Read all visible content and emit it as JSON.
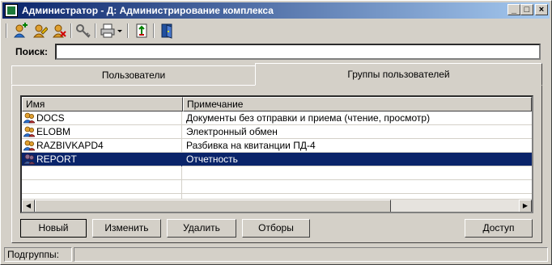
{
  "window": {
    "title": "Администратор - Д: Администрирование комплекса",
    "controls": [
      "_",
      "□",
      "×"
    ]
  },
  "toolbar": {
    "buttons": [
      {
        "icon": "add-user-icon"
      },
      {
        "icon": "edit-user-icon"
      },
      {
        "icon": "delete-user-icon"
      },
      {
        "icon": "key-icon"
      },
      {
        "icon": "printer-icon"
      },
      {
        "icon": "dropdown-arrow-icon"
      },
      {
        "icon": "export-icon"
      },
      {
        "icon": "exit-door-icon"
      }
    ]
  },
  "search": {
    "label": "Поиск:",
    "value": ""
  },
  "tabs": [
    {
      "label": "Пользователи",
      "active": false
    },
    {
      "label": "Группы пользователей",
      "active": true
    }
  ],
  "grid": {
    "columns": [
      "Имя",
      "Примечание"
    ],
    "rows": [
      {
        "name": "DOCS",
        "note": "Документы без отправки и приема (чтение, просмотр)",
        "selected": false
      },
      {
        "name": "ELOBM",
        "note": "Электронный обмен",
        "selected": false
      },
      {
        "name": "RAZBIVKAPD4",
        "note": "Разбивка на квитанции ПД-4",
        "selected": false
      },
      {
        "name": "REPORT",
        "note": "Отчетность",
        "selected": true
      }
    ]
  },
  "buttons": {
    "new": "Новый",
    "edit": "Изменить",
    "delete": "Удалить",
    "filters": "Отборы",
    "access": "Доступ"
  },
  "status": {
    "label": "Подгруппы:",
    "value": ""
  },
  "colors": {
    "title_gradient_start": "#0a246a",
    "title_gradient_end": "#a6caf0",
    "selection": "#0a246a",
    "face": "#d4d0c8"
  }
}
